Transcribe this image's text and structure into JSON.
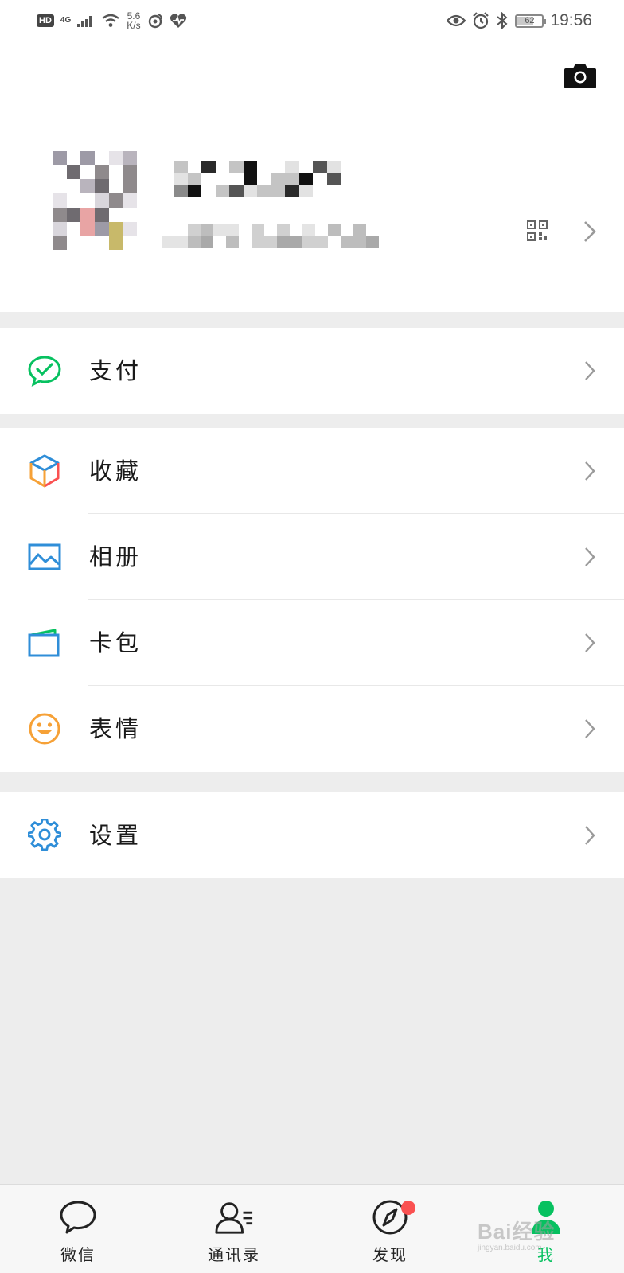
{
  "status_bar": {
    "hd": "HD",
    "network": "4G",
    "speed_value": "5.6",
    "speed_unit": "K/s",
    "battery": "62",
    "time": "19:56",
    "icons": [
      "signal-icon",
      "wifi-icon",
      "weibo-icon",
      "health-icon",
      "eye-icon",
      "alarm-icon",
      "bluetooth-icon"
    ]
  },
  "profile": {
    "camera_icon": "camera-icon",
    "qr_icon": "qr-code-icon",
    "nickname_redacted": true,
    "wechat_id_redacted": true
  },
  "menu": {
    "pay": {
      "label": "支付",
      "icon": "wechat-pay-icon",
      "color": "#07c160"
    },
    "favorites": {
      "label": "收藏",
      "icon": "cube-icon"
    },
    "album": {
      "label": "相册",
      "icon": "picture-icon",
      "color": "#2f8ed8"
    },
    "cards": {
      "label": "卡包",
      "icon": "wallet-icon",
      "color": "#2f8ed8"
    },
    "stickers": {
      "label": "表情",
      "icon": "smiley-icon",
      "color": "#f6a137"
    },
    "settings": {
      "label": "设置",
      "icon": "gear-icon",
      "color": "#2f8ed8"
    }
  },
  "tabs": [
    {
      "label": "微信",
      "icon": "chat-bubble-icon"
    },
    {
      "label": "通讯录",
      "icon": "contacts-icon"
    },
    {
      "label": "发现",
      "icon": "compass-icon",
      "badge": "red-dot"
    },
    {
      "label": "我",
      "icon": "person-icon",
      "active": true
    }
  ],
  "watermark": {
    "brand": "Bai经验",
    "sub": "jingyan.baidu.com"
  },
  "colors": {
    "accent": "#07c160",
    "badge": "#fa5151",
    "background": "#ededed"
  }
}
